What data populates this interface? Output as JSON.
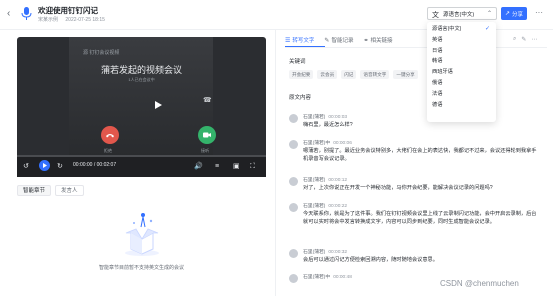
{
  "header": {
    "back_icon": "chevron-left-icon",
    "app_icon": "microphone-icon",
    "title": "欢迎使用钉钉闪记",
    "meta_author": "宋某示例",
    "meta_time": "2022-07-25 18:15",
    "language_select": "源语言(中文)",
    "share_label": "分享",
    "more_label": "···"
  },
  "language_dropdown": {
    "options": [
      "源语言(中文)",
      "英语",
      "日语",
      "韩语",
      "西班牙语",
      "俄语",
      "法语",
      "德语"
    ],
    "selected_index": 0
  },
  "video": {
    "brand": "源 钉钉会议视频",
    "title": "蒲若发起的视频会议",
    "subtitle": "1人已在会议中",
    "label_decline": "拒绝",
    "label_accept": "接听",
    "time": "00:00:00 / 00:02:07",
    "progress": 0.0
  },
  "left_tabs": [
    "智能章节",
    "发言人"
  ],
  "empty_state_text": "智能章节目前暂不支持英文生成的会议",
  "right_panel": {
    "tabs": [
      "转写文字",
      "智能记录",
      "相关链接"
    ],
    "active_tab": 0,
    "keywords_title": "关键词",
    "keywords": [
      "开会纪要",
      "云会员",
      "闪记",
      "语音转文字",
      "一键分享"
    ],
    "original_title": "原文内容",
    "entries": [
      {
        "speaker": "石里(蒲若)",
        "time": "00:00:03",
        "text": "嗨石里，最近怎么样?"
      },
      {
        "speaker": "石里(蒲若)中",
        "time": "00:00:06",
        "text": "嗯蒲若，别提了。最近业务会议特别多，大佬们在会上的表达快，我都记不过来，会议还得轮到我拿手机录音写会议记录。"
      },
      {
        "speaker": "石里(蒲若)",
        "time": "00:00:12",
        "text": "对了，上次你说正在开发一个神秘功能，马你开会纪要，能解决会议记录的问题吗?"
      },
      {
        "speaker": "石里(蒲若)",
        "time": "00:00:22",
        "text": "今天联系你，就是为了这件事。我们在钉钉视频会议里上线了云录制闪记功能，会中开启云录制，后台就可以实时将会中发言转换成文字，内容可以同步到纪要，同时生成智能会议记录。"
      },
      {
        "speaker": "石里(蒲若)",
        "time": "00:00:32",
        "text": "会后可以通过闪记方便检索回溯内容，随时随地会议意思。"
      },
      {
        "speaker": "石里(蒲若)中",
        "time": "00:00:48",
        "text": ""
      }
    ]
  },
  "watermark": "CSDN @chenmuchen",
  "colors": {
    "accent": "#3370ff",
    "decline": "#e2574c",
    "accept": "#34b36b"
  }
}
